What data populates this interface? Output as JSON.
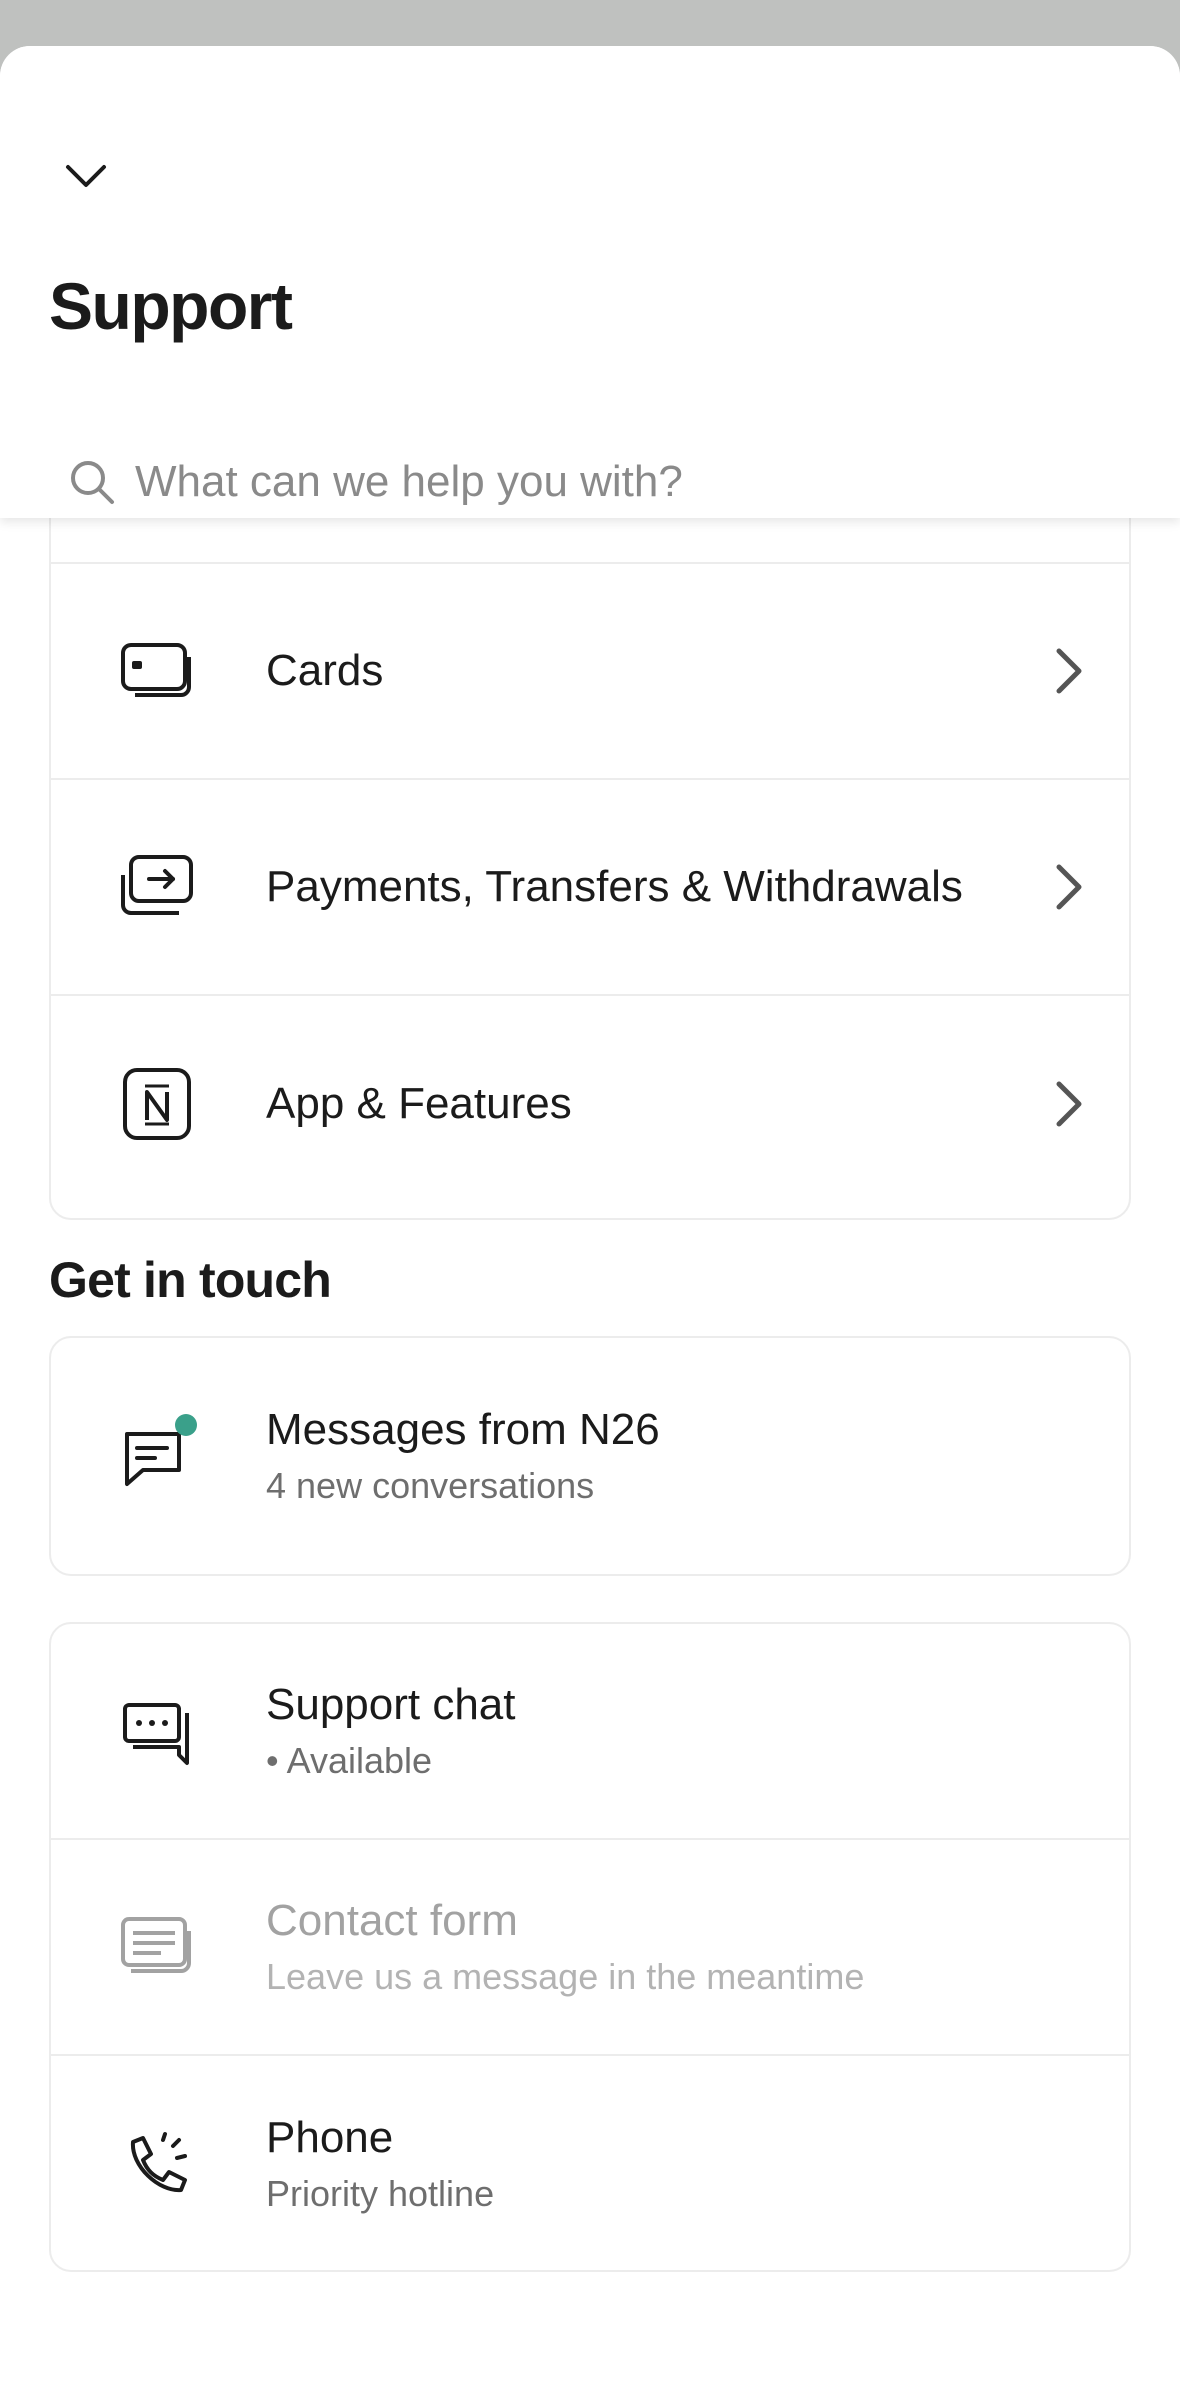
{
  "header": {
    "title": "Support",
    "search": {
      "placeholder": "What can we help you with?"
    }
  },
  "categories": [
    {
      "label": "Cards",
      "icon": "card-icon"
    },
    {
      "label": "Payments, Transfers & Withdrawals",
      "icon": "transfer-icon"
    },
    {
      "label": "App & Features",
      "icon": "n26-app-icon"
    }
  ],
  "contact": {
    "section_title": "Get in touch",
    "messages": {
      "title": "Messages from N26",
      "subtitle": "4 new conversations",
      "icon": "message-icon"
    },
    "chat": {
      "title": "Support chat",
      "subtitle": "• Available",
      "icon": "chat-icon"
    },
    "form": {
      "title": "Contact form",
      "subtitle": "Leave us a message in the meantime",
      "icon": "form-icon"
    },
    "phone": {
      "title": "Phone",
      "subtitle": "Priority hotline",
      "icon": "phone-icon"
    }
  },
  "colors": {
    "accent_dot": "#3aa08a",
    "text": "#1b1b1b",
    "muted": "#6e6e6e",
    "disabled": "#a2a2a2"
  }
}
